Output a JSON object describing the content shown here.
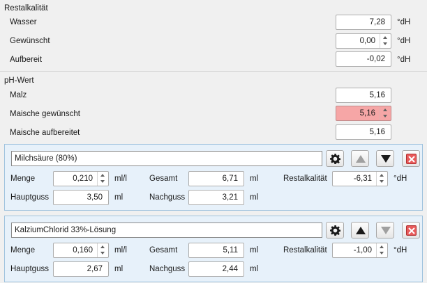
{
  "restalkalitaet": {
    "title": "Restalkalität",
    "rows": [
      {
        "label": "Wasser",
        "value": "7,28",
        "unit": "°dH"
      },
      {
        "label": "Gewünscht",
        "value": "0,00",
        "unit": "°dH"
      },
      {
        "label": "Aufbereit",
        "value": "-0,02",
        "unit": "°dH"
      }
    ]
  },
  "ph": {
    "title": "pH-Wert",
    "rows": [
      {
        "label": "Malz",
        "value": "5,16"
      },
      {
        "label": "Maische gewünscht",
        "value": "5,16"
      },
      {
        "label": "Maische aufbereitet",
        "value": "5,16"
      }
    ]
  },
  "highlight_color": "#f6a6a6",
  "additives": [
    {
      "name": "Milchsäure (80%)",
      "menge_label": "Menge",
      "menge": "0,210",
      "menge_unit": "ml/l",
      "gesamt_label": "Gesamt",
      "gesamt": "6,71",
      "gesamt_unit": "ml",
      "rest_label": "Restalkalität",
      "rest": "-6,31",
      "rest_unit": "°dH",
      "hauptguss_label": "Hauptguss",
      "hauptguss": "3,50",
      "hauptguss_unit": "ml",
      "nachguss_label": "Nachguss",
      "nachguss": "3,21",
      "nachguss_unit": "ml",
      "icons": [
        "gear-icon",
        "arrow-up-icon",
        "arrow-down-icon",
        "delete-icon"
      ],
      "up_enabled": false,
      "down_enabled": true
    },
    {
      "name": "KalziumChlorid 33%-Lösung",
      "menge_label": "Menge",
      "menge": "0,160",
      "menge_unit": "ml/l",
      "gesamt_label": "Gesamt",
      "gesamt": "5,11",
      "gesamt_unit": "ml",
      "rest_label": "Restalkalität",
      "rest": "-1,00",
      "rest_unit": "°dH",
      "hauptguss_label": "Hauptguss",
      "hauptguss": "2,67",
      "hauptguss_unit": "ml",
      "nachguss_label": "Nachguss",
      "nachguss": "2,44",
      "nachguss_unit": "ml",
      "icons": [
        "gear-icon",
        "arrow-up-icon",
        "arrow-down-icon",
        "delete-icon"
      ],
      "up_enabled": true,
      "down_enabled": false
    }
  ]
}
